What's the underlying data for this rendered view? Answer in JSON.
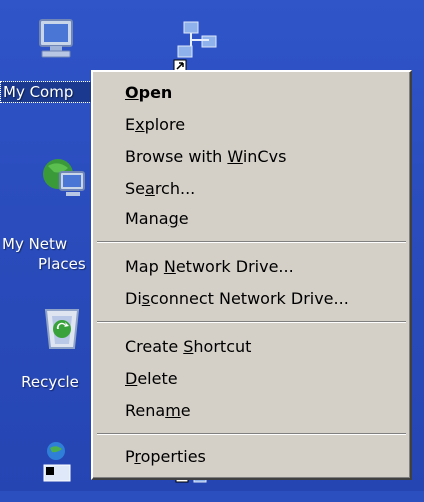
{
  "desktop": {
    "icons": {
      "my_computer": "My Comp",
      "my_network_line1": "My Netw",
      "my_network_line2": "Places",
      "recycle": "Recycle"
    }
  },
  "menu": {
    "items": [
      {
        "label": "Open",
        "accel_index": 0
      },
      {
        "label": "Explore",
        "accel_index": 1
      },
      {
        "label": "Browse with WinCvs",
        "accel_index": 12
      },
      {
        "label": "Search...",
        "accel_index": 2
      },
      {
        "label": "Manage",
        "accel_index": 4
      },
      {
        "label": "Map Network Drive...",
        "accel_index": 4
      },
      {
        "label": "Disconnect Network Drive...",
        "accel_index": 2
      },
      {
        "label": "Create Shortcut",
        "accel_index": 7
      },
      {
        "label": "Delete",
        "accel_index": 0
      },
      {
        "label": "Rename",
        "accel_index": 4
      },
      {
        "label": "Properties",
        "accel_index": 1
      }
    ]
  },
  "colors": {
    "desktop_blue": "#2a4cbc",
    "menu_bg": "#d4d0c8",
    "selection_blue": "#1b3a8f"
  }
}
